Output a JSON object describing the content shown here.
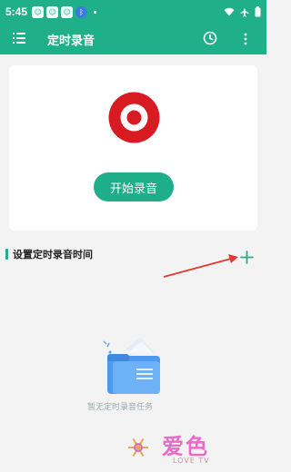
{
  "status_bar": {
    "time": "5:45",
    "notification_icons": [
      "app-icon",
      "app-icon",
      "app-icon",
      "bluetooth-icon"
    ],
    "right_icons": [
      "wifi-icon",
      "airplane-icon",
      "battery-icon"
    ]
  },
  "toolbar": {
    "title": "定时录音",
    "color": "#1fb08a"
  },
  "recorder": {
    "start_label": "开始录音",
    "record_color": "#d81b22"
  },
  "schedule_section": {
    "title": "设置定时录音时间"
  },
  "empty_state": {
    "text": "暂无定时录音任务"
  },
  "watermark": {
    "text": "爱色",
    "subtext": "LOVE TV"
  }
}
